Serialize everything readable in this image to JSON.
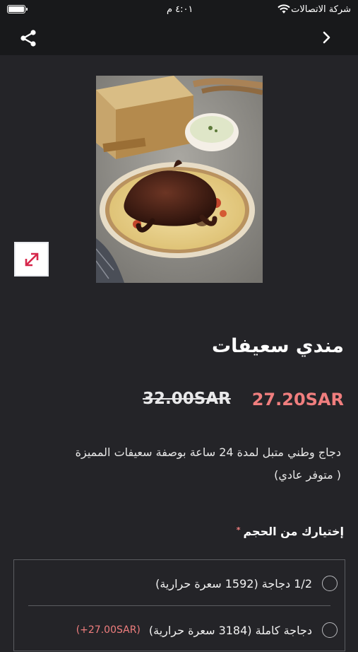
{
  "status_bar": {
    "carrier": "شركة الاتصالات",
    "time": "٤:٠١ م"
  },
  "product": {
    "title": "مندي سعيفات",
    "price": "27.20SAR",
    "old_price": "32.00SAR",
    "description_line1": "دجاج وطني متبل لمدة 24 ساعة بوصفة سعيفات المميزة",
    "description_line2": "( متوفر عادي)"
  },
  "size_section": {
    "label": "إختيارك من الحجم",
    "required_mark": "*",
    "options": [
      {
        "label": "1/2 دجاجة (1592 سعرة حرارية)",
        "extra": ""
      },
      {
        "label": "دجاجة كاملة (3184 سعرة حرارية)",
        "extra": "(+27.00SAR)"
      }
    ]
  },
  "colors": {
    "background": "#242428",
    "accent": "#f07e7e",
    "bar": "#18191b"
  },
  "icons": [
    "share-icon",
    "chevron-right-icon",
    "expand-icon",
    "wifi-icon",
    "battery-icon"
  ]
}
